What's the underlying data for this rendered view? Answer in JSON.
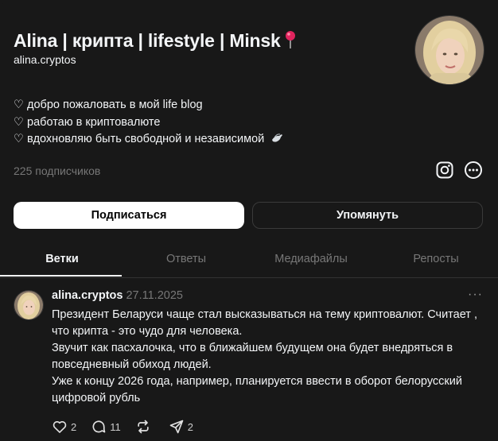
{
  "profile": {
    "name": "Alina | крипта | lifestyle | Minsk",
    "pin_icon": "round-pushpin-icon",
    "handle": "alina.cryptos",
    "bio": [
      "♡ добро пожаловать в мой life blog",
      "♡ работаю в криптовалюте",
      "♡ вдохновляю быть свободной и независимой"
    ],
    "bio_emoji_icon": "dove-icon",
    "followers": "225 подписчиков"
  },
  "actions": {
    "follow_label": "Подписаться",
    "mention_label": "Упомянуть"
  },
  "tabs": [
    {
      "label": "Ветки",
      "active": true
    },
    {
      "label": "Ответы",
      "active": false
    },
    {
      "label": "Медиафайлы",
      "active": false
    },
    {
      "label": "Репосты",
      "active": false
    }
  ],
  "post": {
    "author": "alina.cryptos",
    "date": "27.11.2025",
    "lines": [
      "Президент Беларуси чаще стал высказываться на тему криптовалют. Считает ,",
      "что крипта - это чудо для человека.",
      "Звучит как пасхалочка, что в ближайшем будущем она будет внедряться в",
      "повседневный обиход людей.",
      "Уже к концу 2026 года, например, планируется ввести в оборот белорусский",
      "цифровой рубль"
    ],
    "likes": "2",
    "comments": "11",
    "shares": "2"
  },
  "colors": {
    "background": "#181818",
    "text": "#f3f5f7",
    "muted": "#777777",
    "border": "#333333"
  }
}
